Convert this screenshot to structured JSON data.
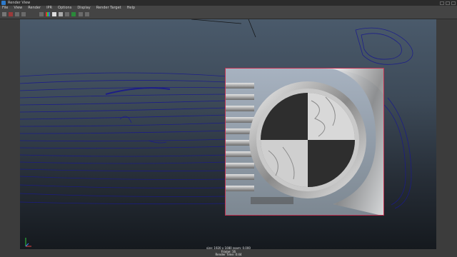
{
  "window": {
    "title": "Render View"
  },
  "menu": [
    "File",
    "View",
    "Render",
    "IPR",
    "Options",
    "Display",
    "Render Target",
    "Help"
  ],
  "toolbar": {
    "camera": "camera1"
  },
  "status": {
    "line1": "size: 1920 x 1080 zoom: 0.000",
    "line2": "Frame: 16",
    "line3": "Render Time: 0:44",
    "line4": "Camera: persp",
    "renderer": "(mental ray, Region)"
  },
  "icons": [
    "app-icon",
    "render-icon",
    "ipr-icon",
    "snapshot-icon",
    "region-icon",
    "rgb-icon",
    "keep-image-icon",
    "remove-image-icon"
  ],
  "colors": {
    "accent": "#2e7bcc",
    "wireframe": "#1a1a8c",
    "region_border": "#c03050"
  }
}
